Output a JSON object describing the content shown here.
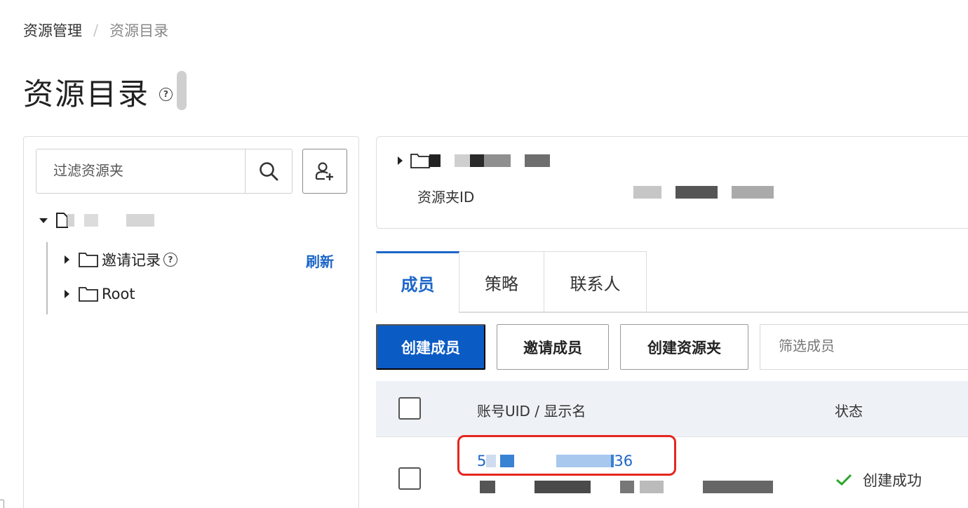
{
  "breadcrumb": {
    "parent": "资源管理",
    "separator": "/",
    "current": "资源目录"
  },
  "page": {
    "title": "资源目录",
    "help_symbol": "?"
  },
  "tree_panel": {
    "filter_placeholder": "过滤资源夹",
    "refresh_label": "刷新",
    "children": [
      {
        "label": "邀请记录",
        "has_help": true
      },
      {
        "label": "Root",
        "has_help": false
      }
    ]
  },
  "info_card": {
    "folder_id_label": "资源夹ID"
  },
  "tabs": [
    {
      "label": "成员",
      "active": true
    },
    {
      "label": "策略",
      "active": false
    },
    {
      "label": "联系人",
      "active": false
    }
  ],
  "toolbar": {
    "create_member": "创建成员",
    "invite_member": "邀请成员",
    "create_folder": "创建资源夹",
    "filter_placeholder": "筛选成员"
  },
  "table": {
    "columns": {
      "uid": "账号UID / 显示名",
      "status": "状态"
    },
    "rows": [
      {
        "uid_prefix": "5",
        "uid_suffix": "36",
        "status": "创建成功"
      }
    ]
  },
  "colors": {
    "accent": "#1c66c8",
    "primary_button": "#0b5bc4",
    "success": "#2aa52a",
    "highlight": "#e5261f",
    "table_header_bg": "#eef1f6"
  },
  "icons": {
    "search": "search-icon",
    "add_user": "add-user-icon",
    "folder": "folder-icon",
    "check": "check-icon"
  }
}
